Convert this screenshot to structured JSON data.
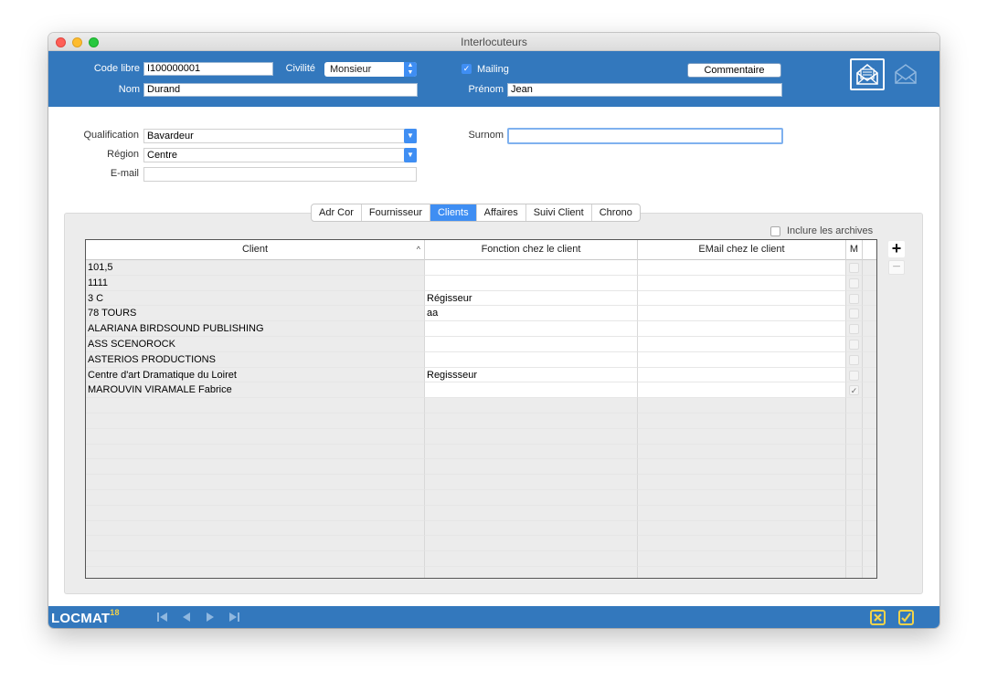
{
  "window": {
    "title": "Interlocuteurs"
  },
  "header": {
    "code_libre_label": "Code libre",
    "code_libre_value": "I100000001",
    "civilite_label": "Civilité",
    "civilite_value": "Monsieur",
    "mailing_label": "Mailing",
    "mailing_checked": true,
    "commentaire_label": "Commentaire",
    "nom_label": "Nom",
    "nom_value": "Durand",
    "prenom_label": "Prénom",
    "prenom_value": "Jean",
    "icons": [
      "mail-open-icon",
      "mail-icon"
    ]
  },
  "form": {
    "qualification_label": "Qualification",
    "qualification_value": "Bavardeur",
    "region_label": "Région",
    "region_value": "Centre",
    "email_label": "E-mail",
    "email_value": "",
    "surnom_label": "Surnom",
    "surnom_value": ""
  },
  "tabs": [
    {
      "label": "Adr Cor",
      "active": false
    },
    {
      "label": "Fournisseur",
      "active": false
    },
    {
      "label": "Clients",
      "active": true
    },
    {
      "label": "Affaires",
      "active": false
    },
    {
      "label": "Suivi Client",
      "active": false
    },
    {
      "label": "Chrono",
      "active": false
    }
  ],
  "archives": {
    "label": "Inclure les archives",
    "checked": false
  },
  "table": {
    "columns": [
      "Client",
      "Fonction chez le client",
      "EMail chez le client",
      "M"
    ],
    "sort_indicator": "^",
    "rows": [
      {
        "client": "101,5",
        "fonction": "",
        "email": "",
        "m": false
      },
      {
        "client": "1111",
        "fonction": "",
        "email": "",
        "m": false
      },
      {
        "client": "3 C",
        "fonction": "Régisseur",
        "email": "",
        "m": false
      },
      {
        "client": "78 TOURS",
        "fonction": "aa",
        "email": "",
        "m": false
      },
      {
        "client": "ALARIANA BIRDSOUND PUBLISHING",
        "fonction": "",
        "email": "",
        "m": false
      },
      {
        "client": "ASS SCENOROCK",
        "fonction": "",
        "email": "",
        "m": false
      },
      {
        "client": "ASTERIOS PRODUCTIONS",
        "fonction": "",
        "email": "",
        "m": false
      },
      {
        "client": "Centre d'art Dramatique du Loiret",
        "fonction": "Regissseur",
        "email": "",
        "m": false
      },
      {
        "client": "MAROUVIN VIRAMALE Fabrice",
        "fonction": "",
        "email": "",
        "m": true
      }
    ]
  },
  "side_buttons": {
    "add": "+",
    "remove": "−"
  },
  "footer": {
    "logo_text": "LOCMAT",
    "logo_version": "18",
    "nav_icons": [
      "first-record-icon",
      "previous-record-icon",
      "next-record-icon",
      "last-record-icon"
    ],
    "action_icons": [
      "cancel-icon",
      "validate-icon"
    ]
  },
  "colors": {
    "header_blue": "#3378bd",
    "accent_blue": "#3f8ef3",
    "logo_yellow": "#f3d34a"
  }
}
